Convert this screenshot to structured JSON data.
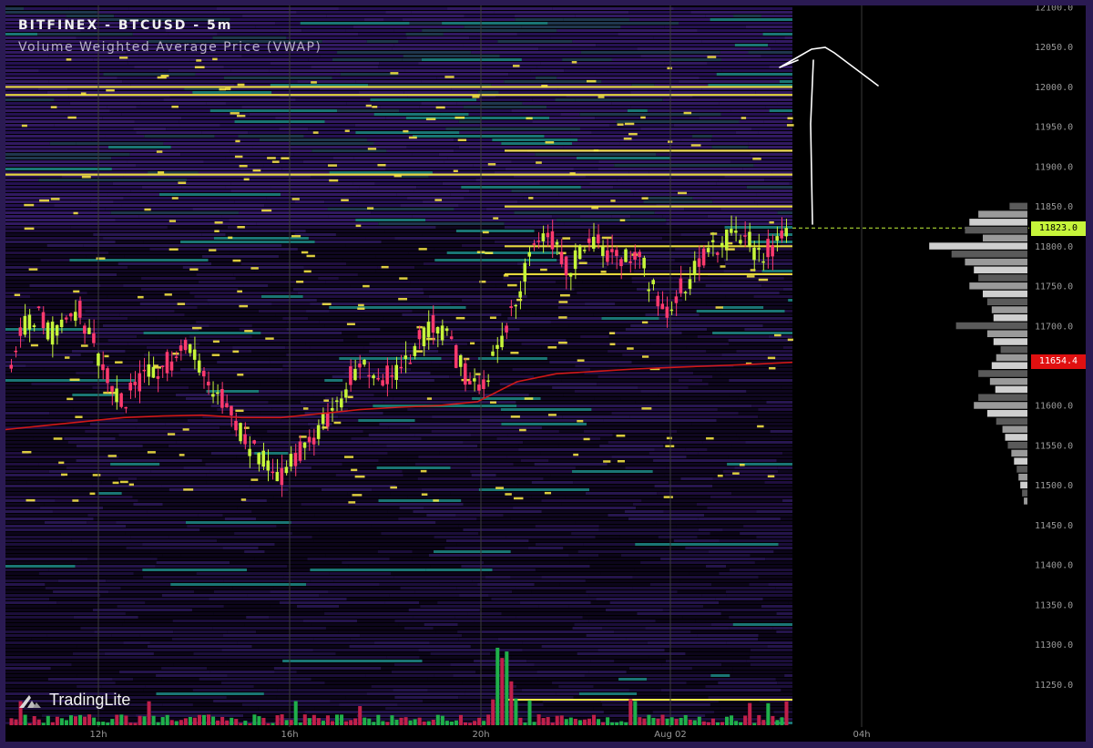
{
  "header": {
    "symbol": "BITFINEX - BTCUSD - 5m",
    "indicator": "Volume Weighted Average Price (VWAP)"
  },
  "logo": {
    "text": "TradingLite",
    "icon": "tradinglite-logo-icon"
  },
  "price_tags": {
    "last": {
      "value": "11823.0",
      "color": "#c6f53a"
    },
    "vwap": {
      "value": "11654.4",
      "color": "#e01010"
    }
  },
  "colors": {
    "background": "#000000",
    "frame": "#2a1a52",
    "candle_up": "#c6f53a",
    "candle_down": "#ff3a6e",
    "vwap": "#d01818",
    "liquidity_strong": "#ffee44",
    "liquidity_mid": "#2ab0b0",
    "liquidity_low": "#4a2a8a"
  },
  "chart_data": {
    "type": "candlestick",
    "exchange": "BITFINEX",
    "pair": "BTCUSD",
    "interval": "5m",
    "ylim": [
      11200,
      12100
    ],
    "y_ticks": [
      "12100.0",
      "12050.0",
      "12000.0",
      "11950.0",
      "11900.0",
      "11850.0",
      "11800.0",
      "11750.0",
      "11700.0",
      "11650.0",
      "11600.0",
      "11550.0",
      "11500.0",
      "11450.0",
      "11400.0",
      "11350.0",
      "11300.0",
      "11250.0"
    ],
    "x_ticks": [
      "12h",
      "16h",
      "20h",
      "Aug 02",
      "04h"
    ],
    "last_price": 11823.0,
    "vwap_last": 11654.4,
    "candles_close_path": [
      11660,
      11700,
      11710,
      11690,
      11705,
      11720,
      11680,
      11640,
      11600,
      11620,
      11640,
      11650,
      11660,
      11680,
      11640,
      11620,
      11600,
      11560,
      11540,
      11520,
      11510,
      11540,
      11560,
      11580,
      11600,
      11640,
      11650,
      11630,
      11640,
      11660,
      11680,
      11700,
      11690,
      11650,
      11620,
      11640,
      11680,
      11720,
      11780,
      11820,
      11800,
      11770,
      11800,
      11810,
      11790,
      11780,
      11800,
      11750,
      11720,
      11740,
      11760,
      11790,
      11800,
      11820,
      11810,
      11790,
      11800,
      11820
    ],
    "vwap_path": [
      11570,
      11575,
      11580,
      11585,
      11587,
      11588,
      11585,
      11585,
      11590,
      11595,
      11598,
      11600,
      11605,
      11630,
      11640,
      11643,
      11646,
      11648,
      11650,
      11652,
      11654.4
    ],
    "strong_liquidity_levels": [
      12000,
      11990,
      11920,
      11890,
      11850,
      11800,
      11765
    ],
    "volume_profile": [
      {
        "price": 11850,
        "volume": 20
      },
      {
        "price": 11840,
        "volume": 55
      },
      {
        "price": 11830,
        "volume": 65
      },
      {
        "price": 11820,
        "volume": 70
      },
      {
        "price": 11810,
        "volume": 50
      },
      {
        "price": 11800,
        "volume": 110
      },
      {
        "price": 11790,
        "volume": 85
      },
      {
        "price": 11780,
        "volume": 70
      },
      {
        "price": 11770,
        "volume": 60
      },
      {
        "price": 11760,
        "volume": 55
      },
      {
        "price": 11750,
        "volume": 65
      },
      {
        "price": 11740,
        "volume": 50
      },
      {
        "price": 11730,
        "volume": 45
      },
      {
        "price": 11720,
        "volume": 40
      },
      {
        "price": 11710,
        "volume": 38
      },
      {
        "price": 11700,
        "volume": 80
      },
      {
        "price": 11690,
        "volume": 45
      },
      {
        "price": 11680,
        "volume": 38
      },
      {
        "price": 11670,
        "volume": 30
      },
      {
        "price": 11660,
        "volume": 35
      },
      {
        "price": 11650,
        "volume": 40
      },
      {
        "price": 11640,
        "volume": 55
      },
      {
        "price": 11630,
        "volume": 42
      },
      {
        "price": 11620,
        "volume": 36
      },
      {
        "price": 11610,
        "volume": 55
      },
      {
        "price": 11600,
        "volume": 60
      },
      {
        "price": 11590,
        "volume": 45
      },
      {
        "price": 11580,
        "volume": 35
      },
      {
        "price": 11570,
        "volume": 28
      },
      {
        "price": 11560,
        "volume": 25
      },
      {
        "price": 11550,
        "volume": 22
      },
      {
        "price": 11540,
        "volume": 18
      },
      {
        "price": 11530,
        "volume": 15
      },
      {
        "price": 11520,
        "volume": 12
      },
      {
        "price": 11510,
        "volume": 10
      },
      {
        "price": 11500,
        "volume": 8
      },
      {
        "price": 11490,
        "volume": 6
      },
      {
        "price": 11480,
        "volume": 4
      }
    ]
  }
}
